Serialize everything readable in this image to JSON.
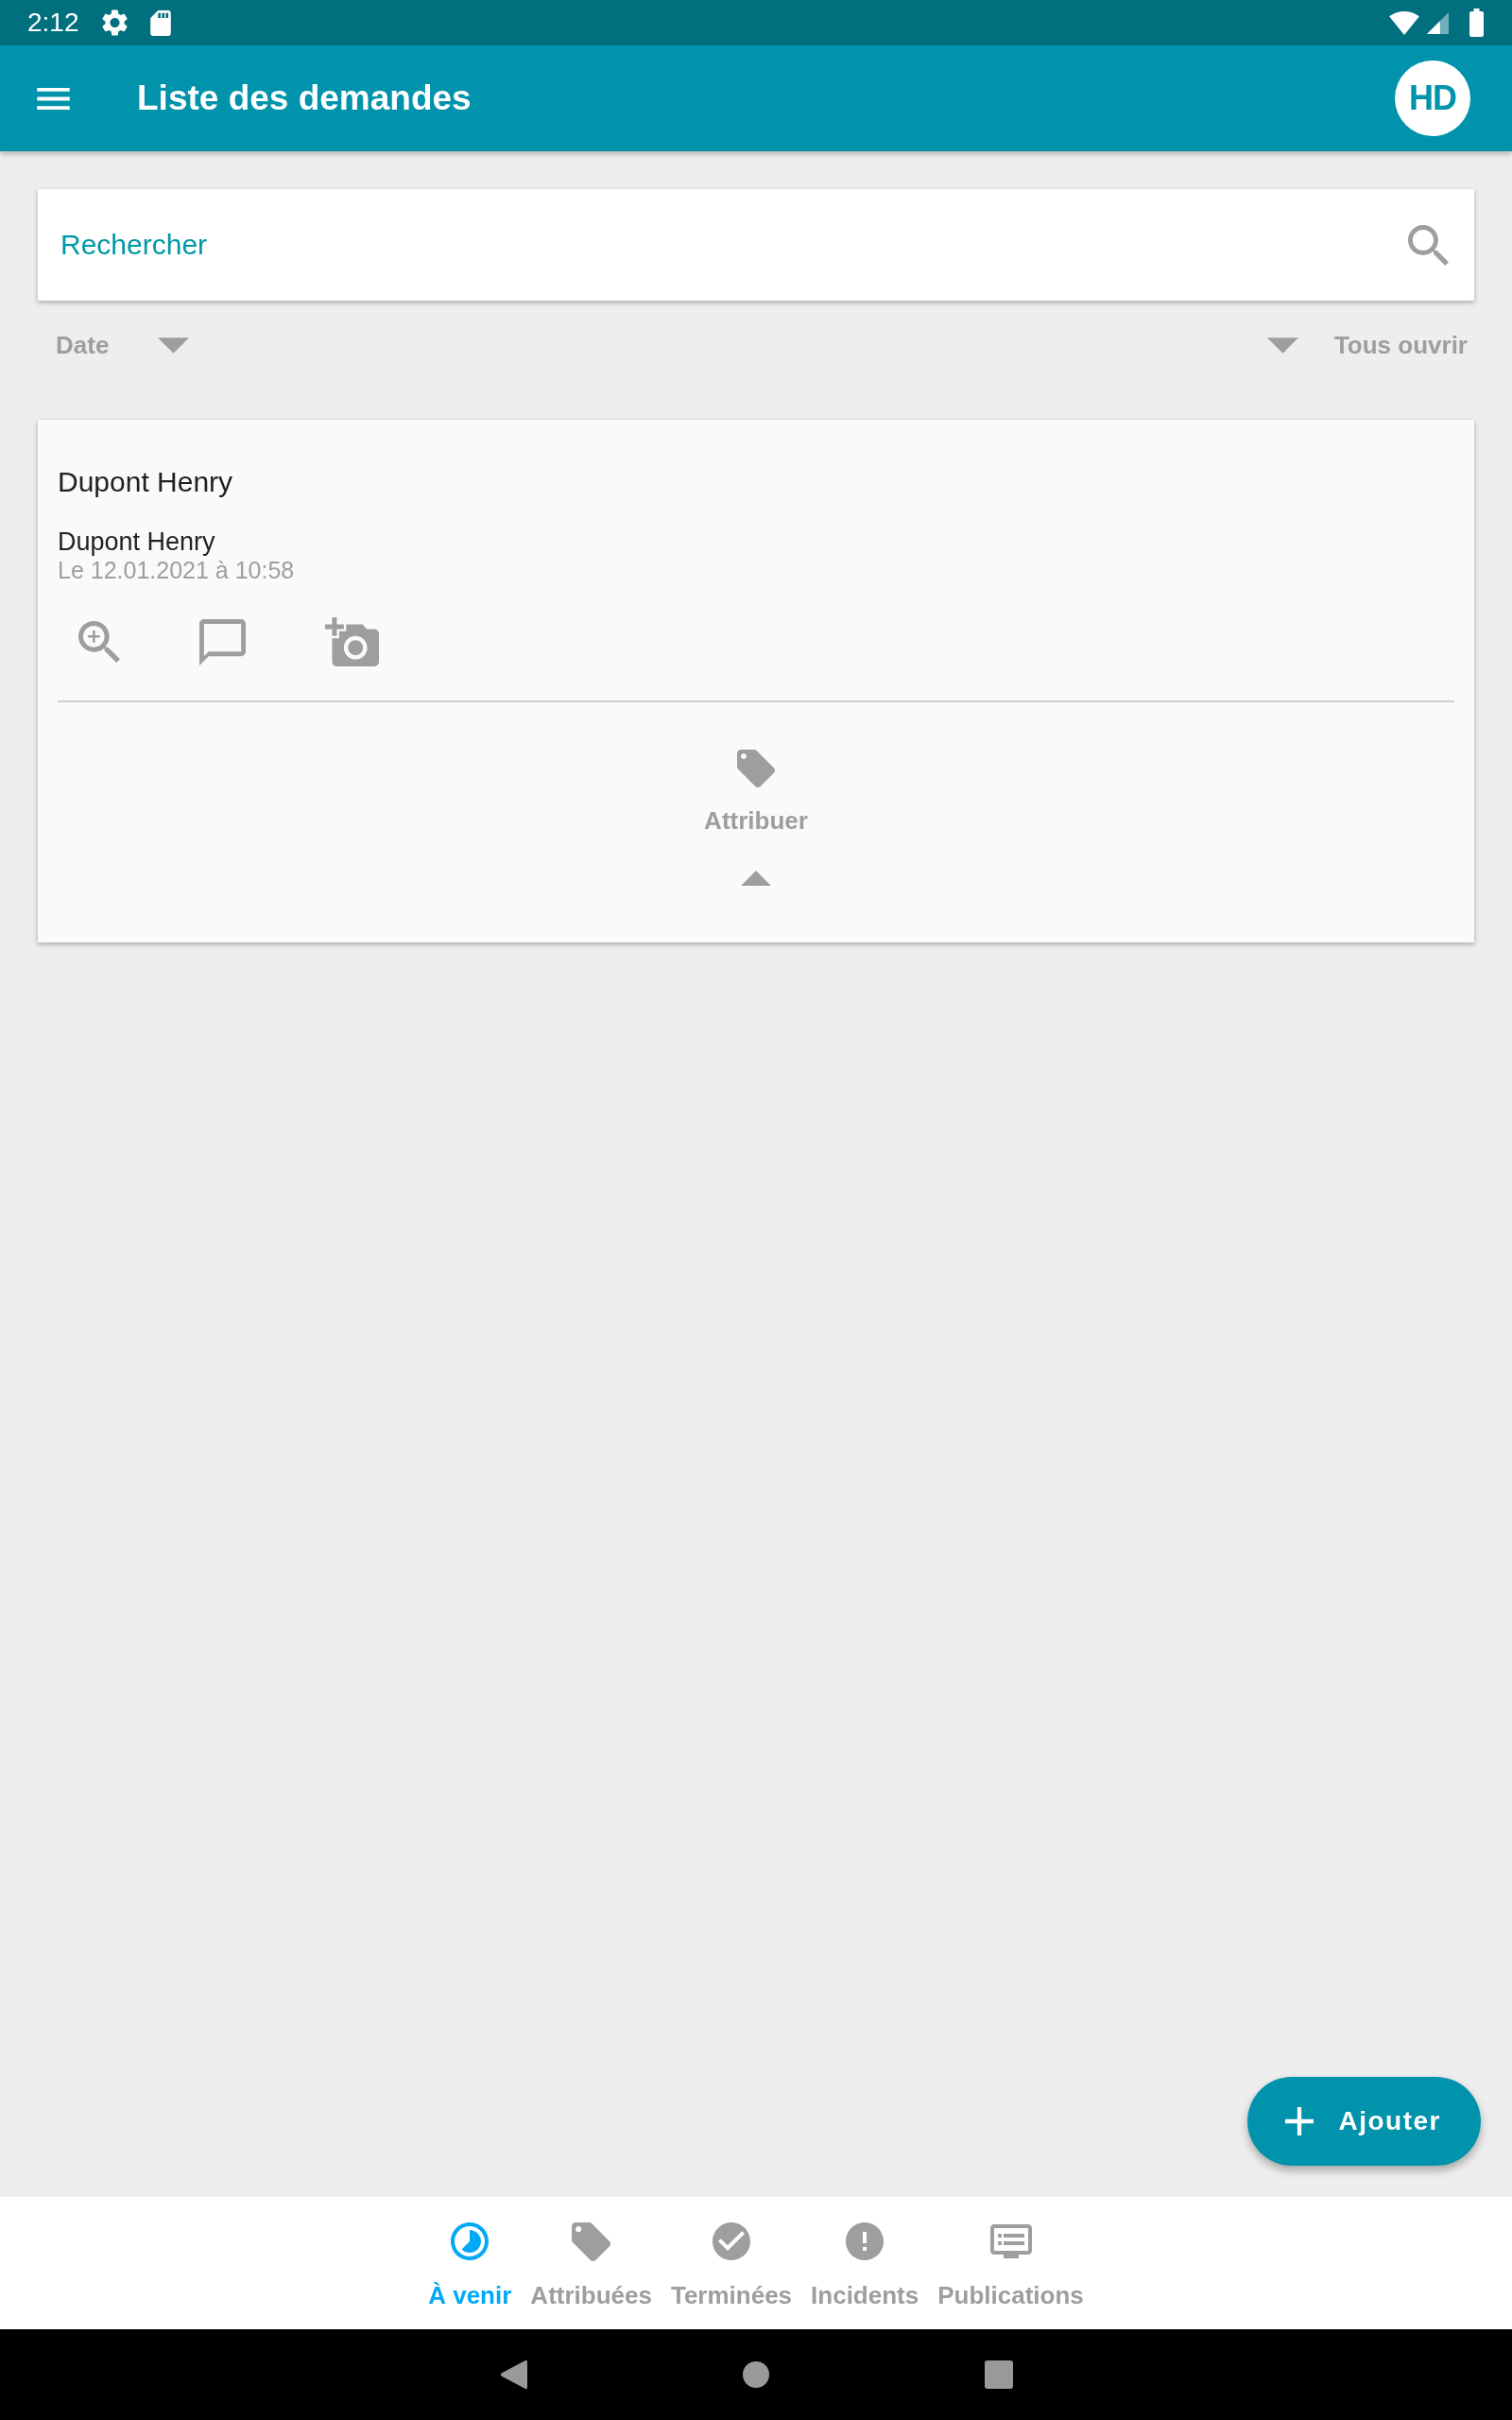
{
  "status_bar": {
    "time": "2:12"
  },
  "app_bar": {
    "title": "Liste des demandes",
    "avatar_initials": "HD"
  },
  "search": {
    "placeholder": "Rechercher"
  },
  "toolbar": {
    "sort_label": "Date",
    "expand_all_label": "Tous ouvrir"
  },
  "requests": [
    {
      "title": "Dupont Henry",
      "requester": "Dupont Henry",
      "date": "Le 12.01.2021 à 10:58",
      "assign_label": "Attribuer",
      "expanded": true
    }
  ],
  "fab": {
    "label": "Ajouter"
  },
  "bottom_nav": [
    {
      "label": "À venir",
      "selected": true
    },
    {
      "label": "Attribuées",
      "selected": false
    },
    {
      "label": "Terminées",
      "selected": false
    },
    {
      "label": "Incidents",
      "selected": false
    },
    {
      "label": "Publications",
      "selected": false
    }
  ]
}
